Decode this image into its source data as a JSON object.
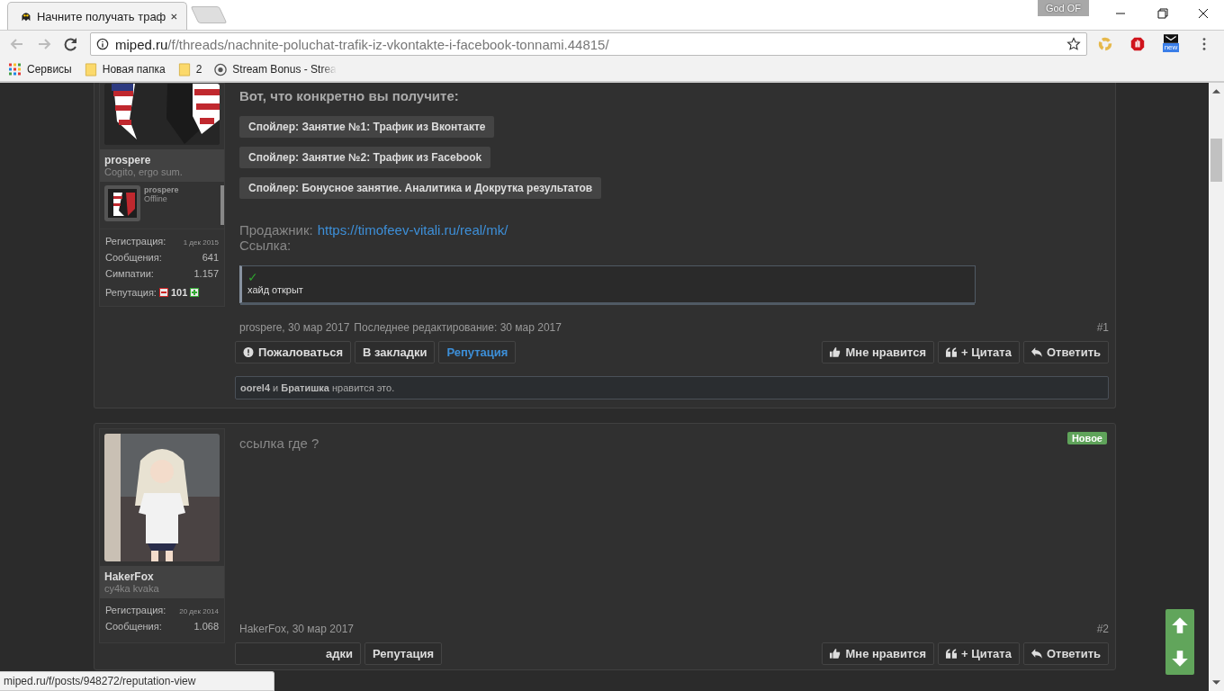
{
  "browser": {
    "tab_title": "Начните получать траф",
    "address": {
      "host": "miped.ru",
      "path": "/f/threads/nachnite-poluchat-trafik-iz-vkontakte-i-facebook-tonnami.44815/"
    },
    "profile_name": "God OF",
    "extension_badge": "new",
    "bookmarks": [
      {
        "label": "Сервисы",
        "kind": "apps"
      },
      {
        "label": "Новая папка",
        "kind": "folder"
      },
      {
        "label": "2",
        "kind": "folder"
      },
      {
        "label": "Stream Bonus - Strea",
        "kind": "site"
      }
    ]
  },
  "posts": [
    {
      "author": "prospere",
      "user_title": "Cogito, ergo sum.",
      "mini_profile": {
        "name": "prospere",
        "status": "Offline"
      },
      "stats": [
        {
          "label": "Регистрация:",
          "value": "1 дек 2015",
          "kind": "date"
        },
        {
          "label": "Сообщения:",
          "value": "641",
          "kind": "number"
        },
        {
          "label": "Симпатии:",
          "value": "1.157",
          "kind": "number"
        }
      ],
      "reputation": {
        "label": "Репутация:",
        "value": "101"
      },
      "content": {
        "heading": "Вот, что конкретно вы получите:",
        "spoilers": [
          "Спойлер: Занятие №1: Трафик из Вконтакте",
          "Спойлер: Занятие №2: Трафик из Facebook",
          "Спойлер: Бонусное занятие. Аналитика и Докрутка результатов"
        ],
        "seller_label": "Продажник:",
        "seller_link": "https://timofeev-vitali.ru/real/mk/",
        "link_label": "Ссылка:",
        "hide_box": {
          "mark": "✓",
          "text": "хайд открыт"
        }
      },
      "meta": {
        "author_date": "prospere, 30 мар 2017",
        "edited": "Последнее редактирование: 30 мар 2017",
        "number": "#1"
      },
      "left_buttons": [
        {
          "label": "Пожаловаться",
          "kind": "report",
          "highlighted": false
        },
        {
          "label": "В закладки",
          "kind": "plain",
          "highlighted": false
        },
        {
          "label": "Репутация",
          "kind": "plain",
          "highlighted": true
        }
      ],
      "right_buttons": [
        {
          "label": "Мне нравится",
          "kind": "like"
        },
        {
          "label": "+ Цитата",
          "kind": "quote"
        },
        {
          "label": "Ответить",
          "kind": "reply"
        }
      ],
      "likes": "**oorel4** и **Братишка** нравится это."
    },
    {
      "author": "HakerFox",
      "user_title": "cy4ka kvaka",
      "badge": "Новое",
      "stats": [
        {
          "label": "Регистрация:",
          "value": "20 дек 2014",
          "kind": "date"
        },
        {
          "label": "Сообщения:",
          "value": "1.068",
          "kind": "number"
        }
      ],
      "content": {
        "message": "ссылка где ?"
      },
      "meta": {
        "author_date": "HakerFox, 30 мар 2017",
        "number": "#2"
      },
      "left_buttons": [
        {
          "label": "адки",
          "kind": "plain",
          "highlighted": false
        },
        {
          "label": "Репутация",
          "kind": "plain",
          "highlighted": false
        }
      ],
      "right_buttons": [
        {
          "label": "Мне нравится",
          "kind": "like"
        },
        {
          "label": "+ Цитата",
          "kind": "quote"
        },
        {
          "label": "Ответить",
          "kind": "reply"
        }
      ]
    }
  ],
  "status_url": "miped.ru/f/posts/948272/reputation-view"
}
